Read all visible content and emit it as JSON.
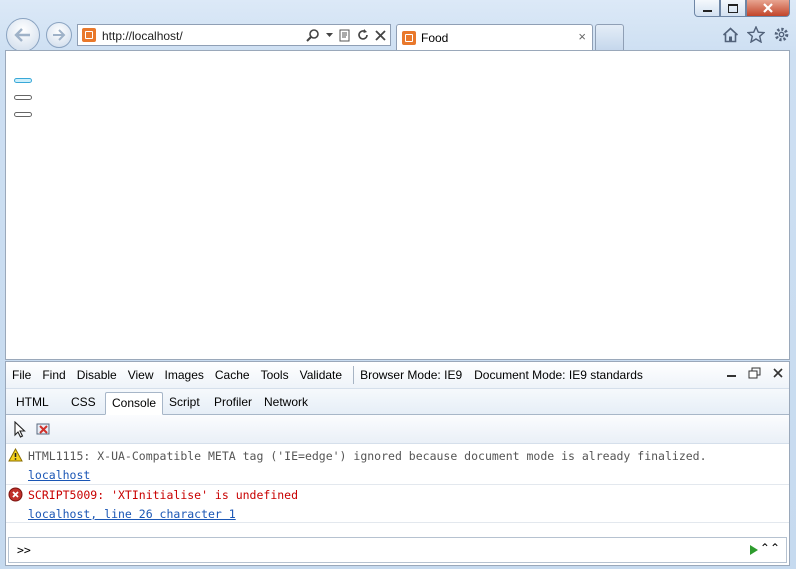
{
  "browser": {
    "address_url": "http://localhost/",
    "tab_title": "Food",
    "tab_close_glyph": "×",
    "window_controls": [
      "minimize-icon",
      "restore-icon",
      "close-icon"
    ],
    "right_tools": [
      "home-icon",
      "favorites-star-icon",
      "settings-gear-icon"
    ]
  },
  "page": {
    "indicators": [
      {
        "state": "active"
      },
      {
        "state": "inactive"
      },
      {
        "state": "inactive"
      }
    ]
  },
  "devtools": {
    "menu": {
      "items": [
        "File",
        "Find",
        "Disable",
        "View",
        "Images",
        "Cache",
        "Tools",
        "Validate"
      ],
      "browser_mode_label": "Browser Mode:",
      "browser_mode_value": "IE9",
      "document_mode_label": "Document Mode:",
      "document_mode_value": "IE9 standards"
    },
    "tabs": [
      "HTML",
      "CSS",
      "Console",
      "Script",
      "Profiler",
      "Network"
    ],
    "active_tab": "Console",
    "messages": [
      {
        "level": "warning",
        "text": "HTML1115: X-UA-Compatible META tag ('IE=edge') ignored because document mode is already finalized.",
        "source": "localhost"
      },
      {
        "level": "error",
        "text": "SCRIPT5009: 'XTInitialise' is undefined",
        "source": "localhost, line 26 character 1"
      }
    ],
    "console_prompt": ">>",
    "expand_glyph": "⌃⌃"
  },
  "colors": {
    "accent_blue": "#39a8d8",
    "error_red": "#c80000",
    "link_blue": "#1a56b5",
    "favicon_orange": "#e9782b"
  }
}
